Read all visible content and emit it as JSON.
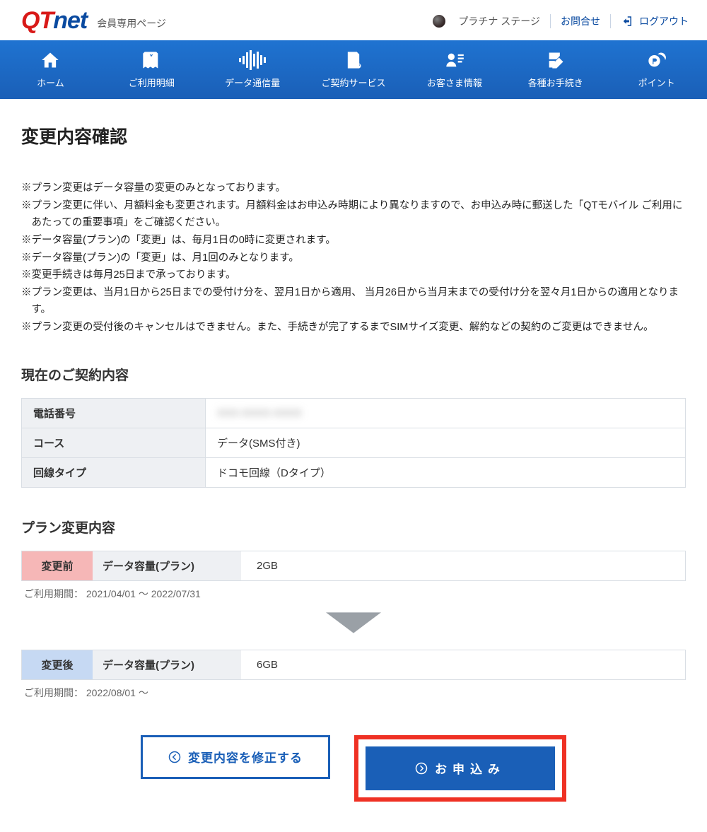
{
  "header": {
    "logo_primary": "QT",
    "logo_secondary": "net",
    "subtitle": "会員専用ページ",
    "stage_label": "プラチナ ステージ",
    "contact_label": "お問合せ",
    "logout_label": "ログアウト"
  },
  "nav": {
    "items": [
      {
        "label": "ホーム"
      },
      {
        "label": "ご利用明細"
      },
      {
        "label": "データ通信量"
      },
      {
        "label": "ご契約サービス"
      },
      {
        "label": "お客さま情報"
      },
      {
        "label": "各種お手続き"
      },
      {
        "label": "ポイント"
      }
    ]
  },
  "page": {
    "title": "変更内容確認",
    "notes": [
      "※プラン変更はデータ容量の変更のみとなっております。",
      "※プラン変更に伴い、月額料金も変更されます。月額料金はお申込み時期により異なりますので、お申込み時に郵送した「QTモバイル ご利用にあたっての重要事項」をご確認ください。",
      "※データ容量(プラン)の「変更」は、毎月1日の0時に変更されます。",
      "※データ容量(プラン)の「変更」は、月1回のみとなります。",
      "※変更手続きは毎月25日まで承っております。",
      "※プラン変更は、当月1日から25日までの受付け分を、翌月1日から適用、 当月26日から当月末までの受付け分を翌々月1日からの適用となります。",
      "※プラン変更の受付後のキャンセルはできません。また、手続きが完了するまでSIMサイズ変更、解約などの契約のご変更はできません。"
    ],
    "current_section_title": "現在のご契約内容",
    "current": {
      "rows": [
        {
          "label": "電話番号",
          "value": "XXX-XXXX-XXXX",
          "masked": true
        },
        {
          "label": "コース",
          "value": "データ(SMS付き)",
          "masked": false
        },
        {
          "label": "回線タイプ",
          "value": "ドコモ回線（Dタイプ）",
          "masked": false
        }
      ]
    },
    "change_section_title": "プラン変更内容",
    "change": {
      "before_tag": "変更前",
      "after_tag": "変更後",
      "row_label": "データ容量(プラン)",
      "before_value": "2GB",
      "before_period": "ご利用期間： 2021/04/01 ～ 2022/07/31",
      "after_value": "6GB",
      "after_period": "ご利用期間： 2022/08/01 ～"
    },
    "actions": {
      "edit_label": "変更内容を修正する",
      "submit_label": "お申込み"
    }
  }
}
